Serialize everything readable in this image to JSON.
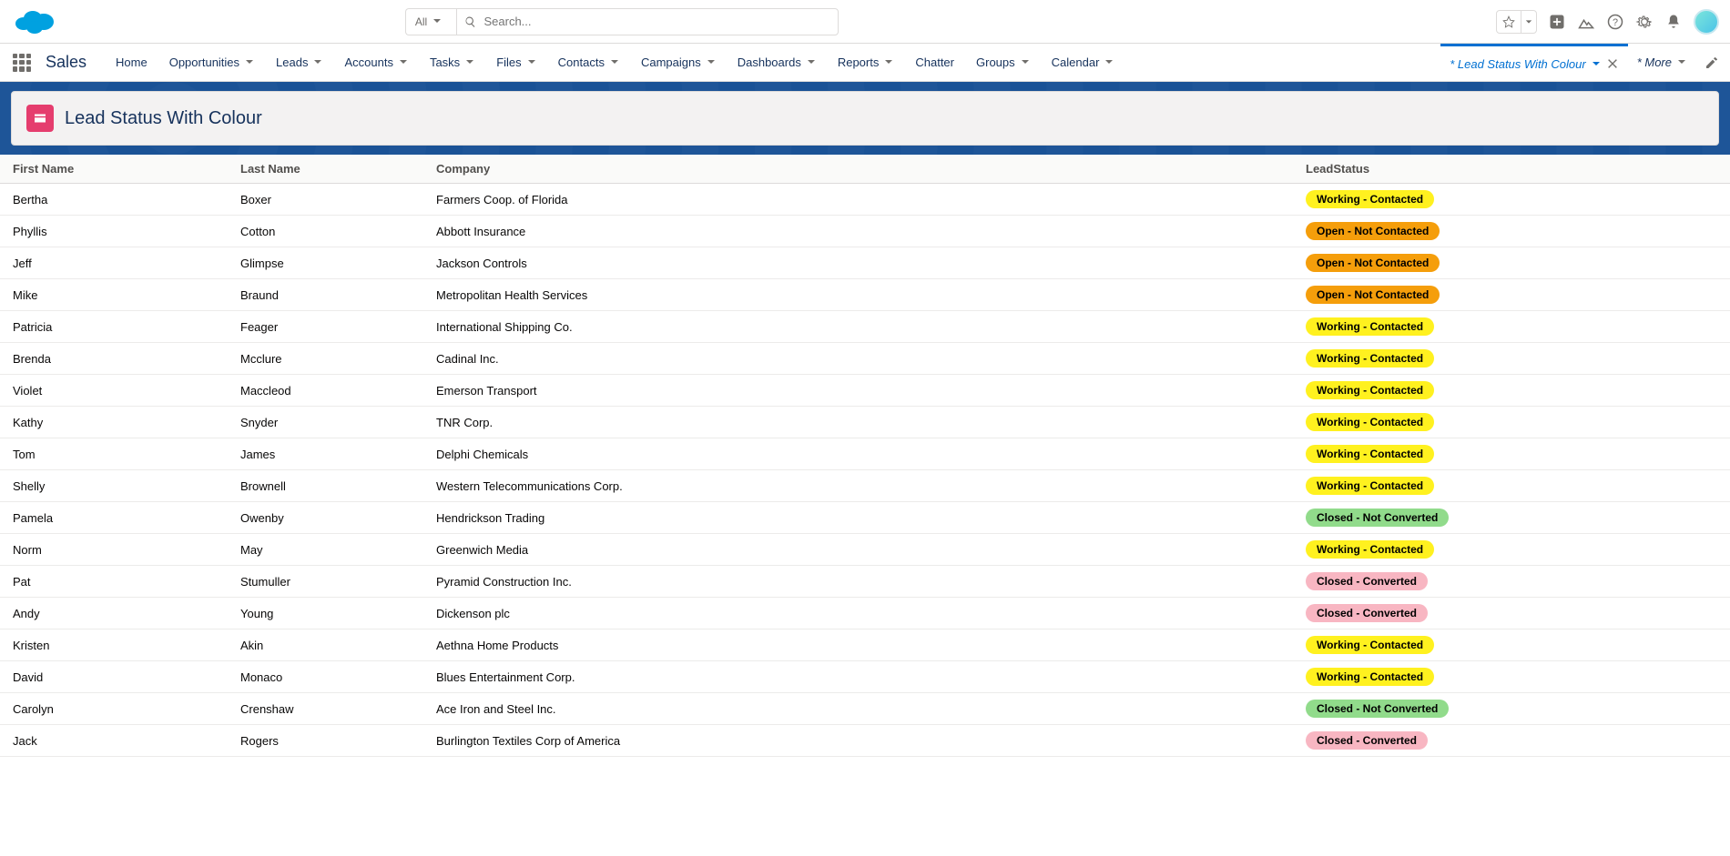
{
  "search": {
    "all": "All",
    "placeholder": "Search..."
  },
  "app_name": "Sales",
  "nav": [
    "Home",
    "Opportunities",
    "Leads",
    "Accounts",
    "Tasks",
    "Files",
    "Contacts",
    "Campaigns",
    "Dashboards",
    "Reports",
    "Chatter",
    "Groups",
    "Calendar"
  ],
  "nav_no_chevron": [
    "Home",
    "Chatter"
  ],
  "tab_active": "* Lead Status With Colour",
  "more_tab": "* More",
  "page_title": "Lead Status With Colour",
  "columns": [
    "First Name",
    "Last Name",
    "Company",
    "LeadStatus"
  ],
  "status_styles": {
    "Working - Contacted": "working",
    "Open - Not Contacted": "open",
    "Closed - Not Converted": "closednc",
    "Closed - Converted": "closedc"
  },
  "rows": [
    {
      "first": "Bertha",
      "last": "Boxer",
      "company": "Farmers Coop. of Florida",
      "status": "Working - Contacted"
    },
    {
      "first": "Phyllis",
      "last": "Cotton",
      "company": "Abbott Insurance",
      "status": "Open - Not Contacted"
    },
    {
      "first": "Jeff",
      "last": "Glimpse",
      "company": "Jackson Controls",
      "status": "Open - Not Contacted"
    },
    {
      "first": "Mike",
      "last": "Braund",
      "company": "Metropolitan Health Services",
      "status": "Open - Not Contacted"
    },
    {
      "first": "Patricia",
      "last": "Feager",
      "company": "International Shipping Co.",
      "status": "Working - Contacted"
    },
    {
      "first": "Brenda",
      "last": "Mcclure",
      "company": "Cadinal Inc.",
      "status": "Working - Contacted"
    },
    {
      "first": "Violet",
      "last": "Maccleod",
      "company": "Emerson Transport",
      "status": "Working - Contacted"
    },
    {
      "first": "Kathy",
      "last": "Snyder",
      "company": "TNR Corp.",
      "status": "Working - Contacted"
    },
    {
      "first": "Tom",
      "last": "James",
      "company": "Delphi Chemicals",
      "status": "Working - Contacted"
    },
    {
      "first": "Shelly",
      "last": "Brownell",
      "company": "Western Telecommunications Corp.",
      "status": "Working - Contacted"
    },
    {
      "first": "Pamela",
      "last": "Owenby",
      "company": "Hendrickson Trading",
      "status": "Closed - Not Converted"
    },
    {
      "first": "Norm",
      "last": "May",
      "company": "Greenwich Media",
      "status": "Working - Contacted"
    },
    {
      "first": "Pat",
      "last": "Stumuller",
      "company": "Pyramid Construction Inc.",
      "status": "Closed - Converted"
    },
    {
      "first": "Andy",
      "last": "Young",
      "company": "Dickenson plc",
      "status": "Closed - Converted"
    },
    {
      "first": "Kristen",
      "last": "Akin",
      "company": "Aethna Home Products",
      "status": "Working - Contacted"
    },
    {
      "first": "David",
      "last": "Monaco",
      "company": "Blues Entertainment Corp.",
      "status": "Working - Contacted"
    },
    {
      "first": "Carolyn",
      "last": "Crenshaw",
      "company": "Ace Iron and Steel Inc.",
      "status": "Closed - Not Converted"
    },
    {
      "first": "Jack",
      "last": "Rogers",
      "company": "Burlington Textiles Corp of America",
      "status": "Closed - Converted"
    }
  ]
}
